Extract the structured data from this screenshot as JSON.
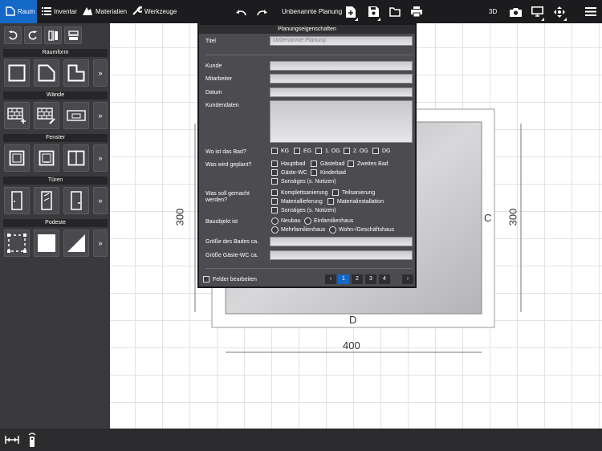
{
  "toolbar": {
    "raum": "Raum",
    "inventar": "Inventar",
    "materialien": "Materialien",
    "werkzeuge": "Werkzeuge",
    "plan_name": "Unbenannte Planung",
    "view3d": "3D"
  },
  "sidebar": {
    "raumform": "Raumform",
    "waende": "Wände",
    "fenster": "Fenster",
    "tueren": "Türen",
    "podeste": "Podeste",
    "more": "»"
  },
  "canvas": {
    "label_c": "C",
    "label_d": "D",
    "dim_left": "300",
    "dim_right": "300",
    "dim_bottom": "400"
  },
  "dialog": {
    "title": "Planungseigenschaften",
    "titel_label": "Titel",
    "titel_placeholder": "Unbenannte Planung",
    "kunde": "Kunde",
    "mitarbeiter": "Mitarbeiter",
    "datum": "Datum",
    "kundendaten": "Kundendaten",
    "wo_label": "Wo ist das Bad?",
    "wo_options": [
      "KG",
      "EG",
      "1. OG",
      "2. OG",
      "DG"
    ],
    "was_label": "Was wird geplant?",
    "was_options": [
      "Hauptbad",
      "Gästebad",
      "Zweites Bad",
      "Gäste-WC",
      "Kinderbad",
      "Sonstiges (s. Notizen)"
    ],
    "gemacht_label": "Was soll gemacht werden?",
    "gemacht_options": [
      "Komplettsanierung",
      "Teilsanierung",
      "Materiallieferung",
      "Materialinstallation",
      "Sonstiges (s. Notizen)"
    ],
    "bauobjekt_label": "Bauobjekt ist",
    "bauobjekt_options": [
      "Neubau",
      "Einfamilienhaus",
      "Mehrfamilienhaus",
      "Wohn-/Geschäftshaus"
    ],
    "groesse_bad": "Größe des Bades ca.",
    "groesse_wc": "Größe Gäste-WC ca.",
    "felder": "Felder bearbeiten",
    "pages": [
      "1",
      "2",
      "3",
      "4"
    ],
    "prev": "‹",
    "next": "›"
  },
  "colors": {
    "accent": "#1468c8",
    "topbar": "#1c1c1e",
    "sidebar": "#3a3a3d",
    "dialog": "#4c4c50"
  }
}
